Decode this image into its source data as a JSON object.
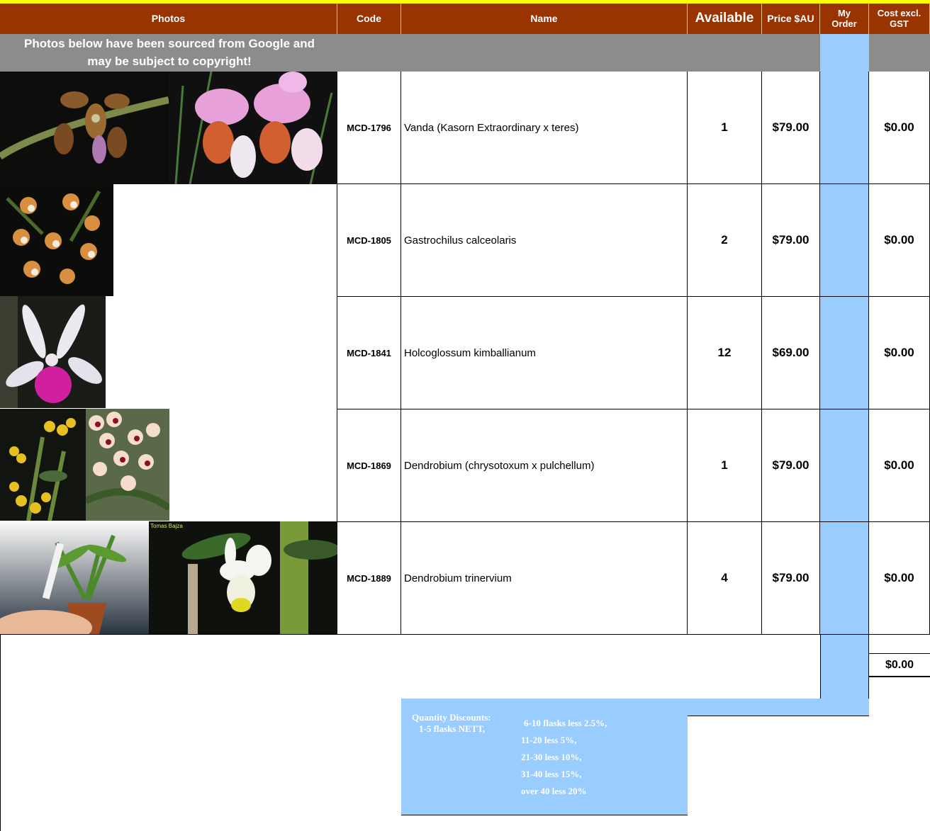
{
  "header": {
    "photos": "Photos",
    "code": "Code",
    "name": "Name",
    "available": "Available",
    "price": "Price $AU",
    "my_order_l1": "My",
    "my_order_l2": "Order",
    "cost_l1": "Cost excl.",
    "cost_l2": "GST"
  },
  "notice": {
    "line1": "Photos below have been sourced from Google and",
    "line2": "may be subject to copyright!"
  },
  "rows": [
    {
      "code": "MCD-1796",
      "name": "Vanda (Kasorn Extraordinary x teres)",
      "available": "1",
      "price": "$79.00",
      "order": "",
      "cost": "$0.00"
    },
    {
      "code": "MCD-1805",
      "name": "Gastrochilus calceolaris",
      "available": "2",
      "price": "$79.00",
      "order": "",
      "cost": "$0.00"
    },
    {
      "code": "MCD-1841",
      "name": "Holcoglossum kimballianum",
      "available": "12",
      "price": "$69.00",
      "order": "",
      "cost": "$0.00"
    },
    {
      "code": "MCD-1869",
      "name": "Dendrobium (chrysotoxum x pulchellum)",
      "available": "1",
      "price": "$79.00",
      "order": "",
      "cost": "$0.00"
    },
    {
      "code": "MCD-1889",
      "name": "Dendrobium trinervium",
      "available": "4",
      "price": "$79.00",
      "order": "",
      "cost": "$0.00"
    }
  ],
  "total": "$0.00",
  "photo_credit": "Tomas Bajza",
  "discounts": {
    "title": "Quantity Discounts:",
    "first": "1-5 flasks NETT,",
    "lines": [
      "6-10 flasks less 2.5%,",
      "11-20 less 5%,",
      "21-30 less 10%,",
      "31-40 less 15%,",
      "over 40 less 20%"
    ]
  },
  "colors": {
    "header_bg": "#993300",
    "header_top": "#ffff00",
    "notice_bg": "#8c8c8c",
    "order_col_bg": "#99ccff"
  }
}
